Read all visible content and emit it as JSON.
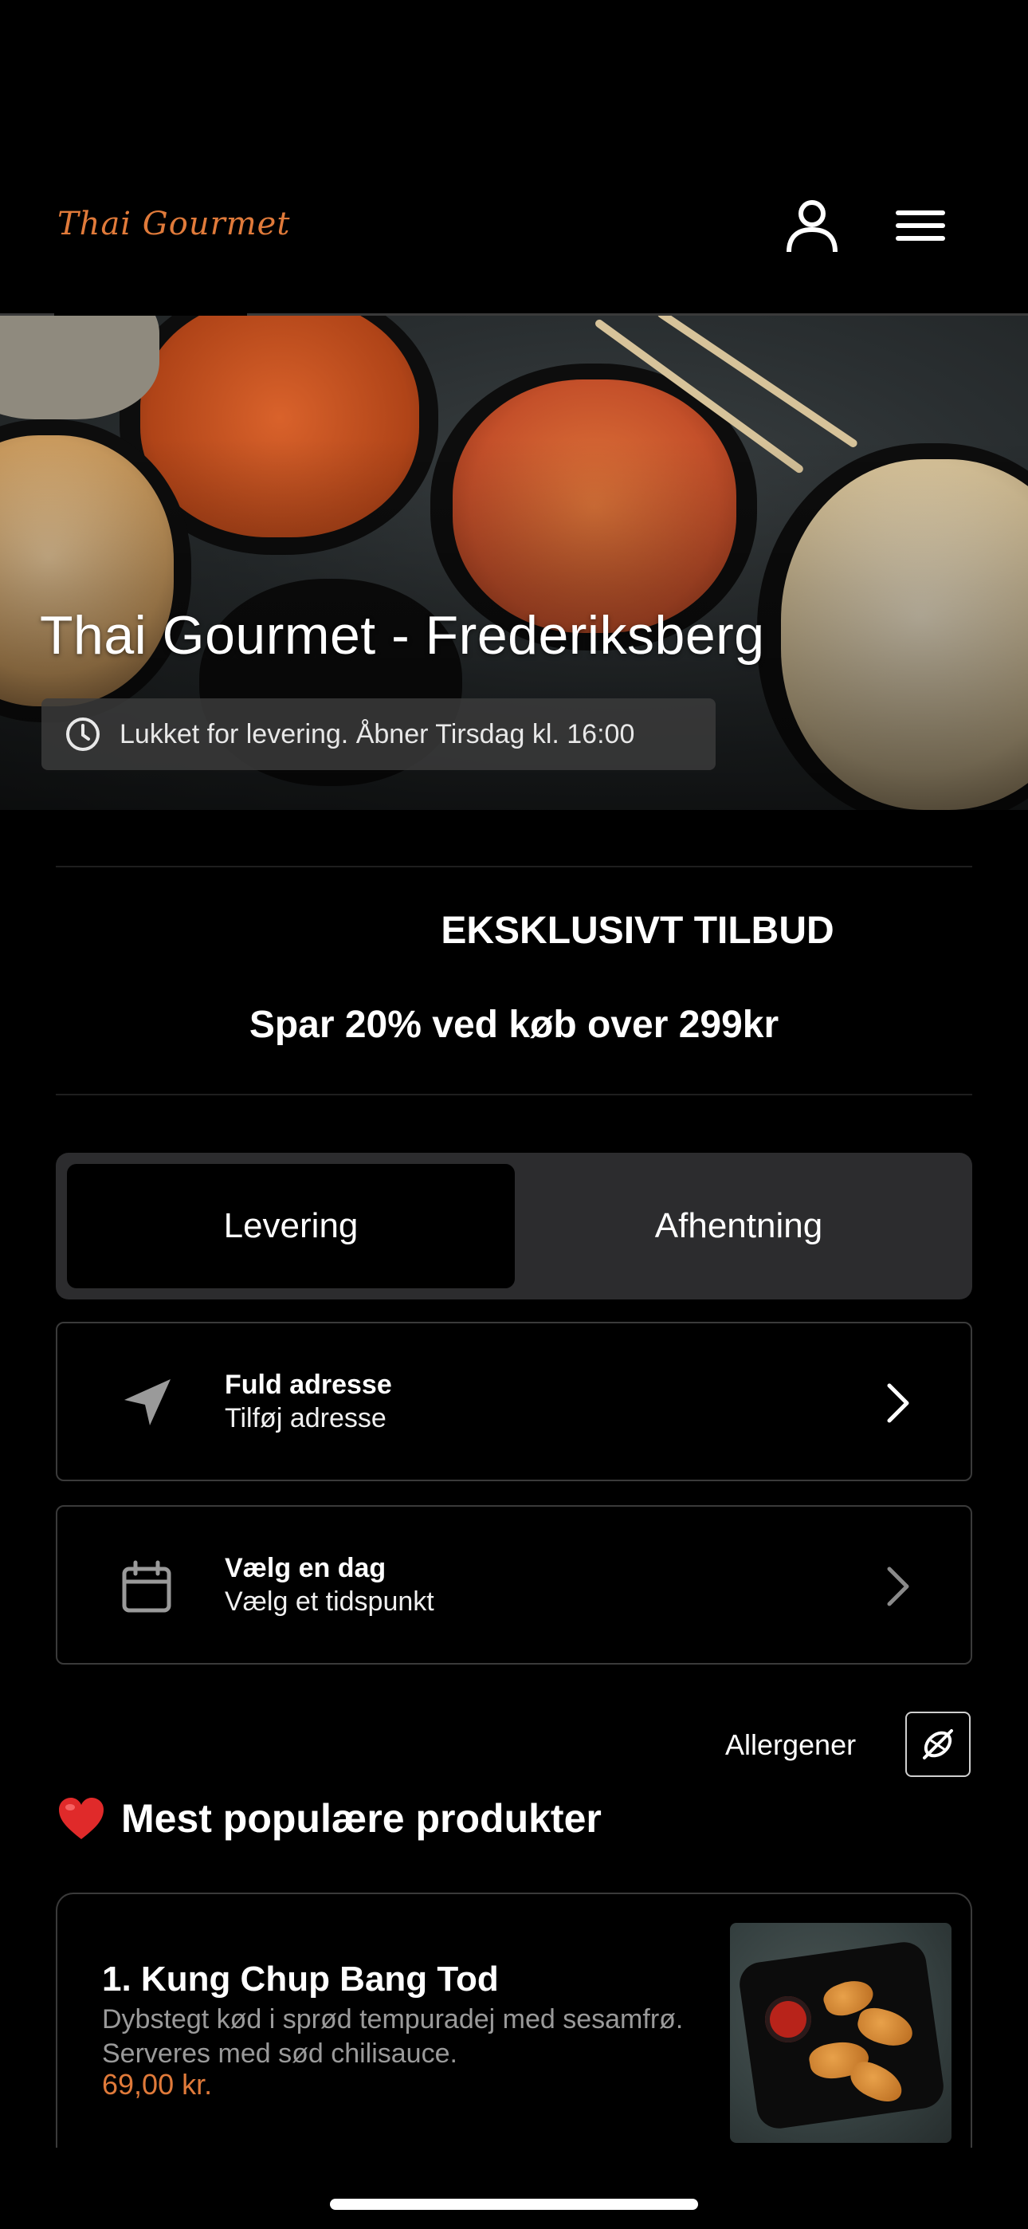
{
  "header": {
    "logo_text": "Thai Gourmet",
    "user_icon": "user-icon",
    "menu_icon": "hamburger-menu-icon"
  },
  "hero": {
    "title": "Thai Gourmet - Frederiksberg",
    "status_icon": "clock-icon",
    "status_text": "Lukket for levering. Åbner Tirsdag kl. 16:00"
  },
  "offer": {
    "label": "EKSKLUSIVT TILBUD",
    "text": "Spar 20% ved køb over 299kr"
  },
  "delivery_toggle": {
    "options": [
      {
        "label": "Levering",
        "selected": true
      },
      {
        "label": "Afhentning",
        "selected": false
      }
    ]
  },
  "address": {
    "icon": "location-arrow-icon",
    "title": "Fuld adresse",
    "subtitle": "Tilføj adresse"
  },
  "schedule": {
    "icon": "calendar-icon",
    "title": "Vælg en dag",
    "subtitle": "Vælg et tidspunkt"
  },
  "allergens": {
    "label": "Allergener",
    "icon": "allergen-filter-icon"
  },
  "popular": {
    "heading": "Mest populære produkter",
    "icon": "heart-icon",
    "products": [
      {
        "name": "1. Kung Chup Bang Tod",
        "description": "Dybstegt kød i sprød tempuradej med sesamfrø. Serveres med sød chilisauce.",
        "price": "69,00 kr."
      }
    ]
  },
  "colors": {
    "accent": "#e07a3a",
    "background": "#000000",
    "card_border": "#3a3a3a",
    "toggle_bg": "#2c2c2e"
  }
}
